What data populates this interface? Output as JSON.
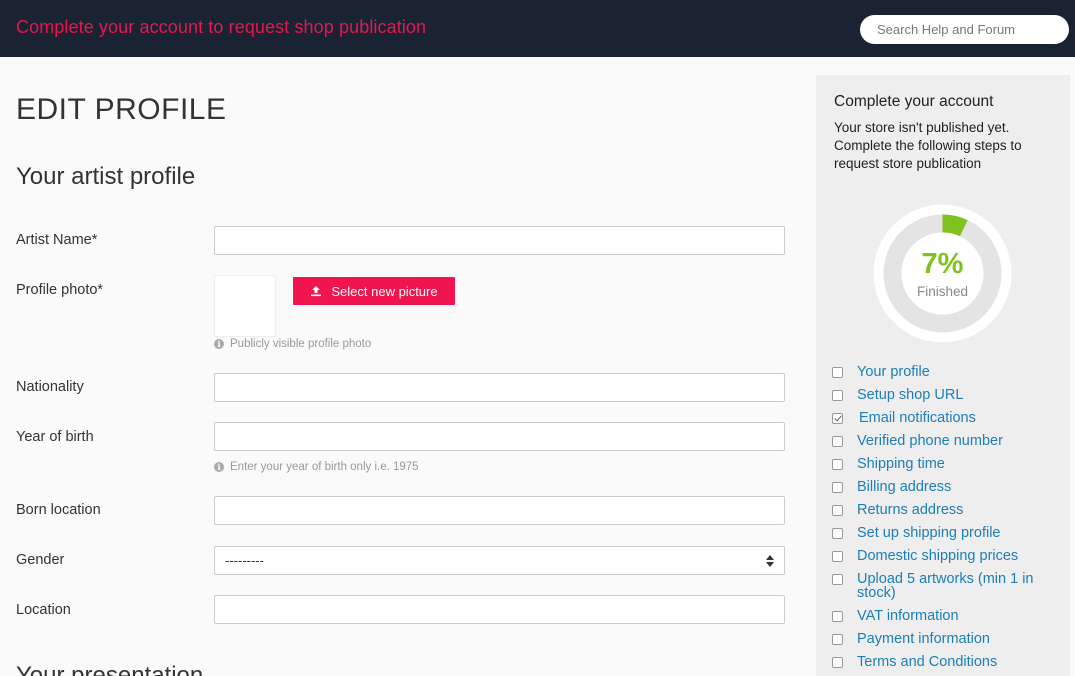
{
  "header": {
    "title": "Complete your account to request shop publication",
    "search_placeholder": "Search Help and Forum"
  },
  "main": {
    "page_title": "EDIT PROFILE",
    "section_title": "Your artist profile",
    "fields": {
      "artist_name": "Artist Name*",
      "profile_photo": "Profile photo*",
      "nationality": "Nationality",
      "year_of_birth": "Year of birth",
      "born_location": "Born location",
      "gender": "Gender",
      "location": "Location"
    },
    "upload_button": "Select new picture",
    "photo_hint": "Publicly visible profile photo",
    "year_hint": "Enter your year of birth only i.e. 1975",
    "gender_selected": "---------",
    "next_section_title": "Your presentation"
  },
  "sidebar": {
    "title": "Complete your account",
    "description": "Your store isn't published yet. Complete the following steps to request store publication",
    "progress_percent": 7,
    "progress_text": "7%",
    "progress_label": "Finished",
    "steps": [
      {
        "label": "Your profile",
        "checked": false
      },
      {
        "label": "Setup shop URL",
        "checked": false
      },
      {
        "label": "Email notifications",
        "checked": true
      },
      {
        "label": "Verified phone number",
        "checked": false
      },
      {
        "label": "Shipping time",
        "checked": false
      },
      {
        "label": "Billing address",
        "checked": false
      },
      {
        "label": "Returns address",
        "checked": false
      },
      {
        "label": "Set up shipping profile",
        "checked": false
      },
      {
        "label": "Domestic shipping prices",
        "checked": false
      },
      {
        "label": "Upload 5 artworks (min 1 in stock)",
        "checked": false
      },
      {
        "label": "VAT information",
        "checked": false
      },
      {
        "label": "Payment information",
        "checked": false
      },
      {
        "label": "Terms and Conditions",
        "checked": false
      }
    ]
  },
  "colors": {
    "header_bg": "#1a2332",
    "accent": "#e8164f",
    "progress_green": "#80c31f",
    "link_blue": "#1d7fb5"
  }
}
